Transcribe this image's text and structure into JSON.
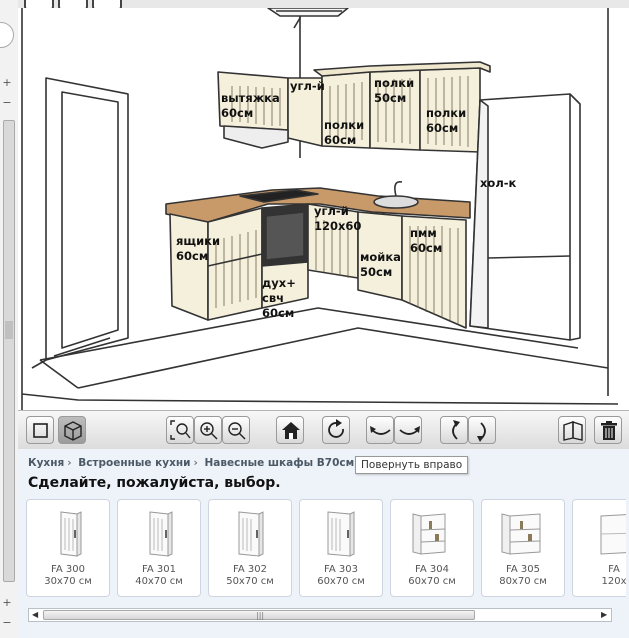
{
  "viewport": {
    "labels": {
      "hood": "вытяжка\n60см",
      "corner_wall": "угл-й",
      "shelf_60_a": "полки\n60см",
      "shelf_50": "полки\n50см",
      "shelf_60_b": "полки\n60см",
      "fridge": "хол-к",
      "drawers": "ящики\n60см",
      "corner_base": "угл-й\n120x60",
      "dishwasher": "пмм\n60см",
      "sink": "мойка\n50см",
      "oven": "дух+\nсвч\n60см"
    }
  },
  "toolbar": {
    "tooltip": "Повернуть вправо"
  },
  "catalog": {
    "breadcrumb": [
      "Кухня",
      "Встроенные кухни",
      "Навесные шкафы B70см"
    ],
    "title": "Сделайте, пожалуйста, выбор.",
    "products": [
      {
        "name": "FA 300",
        "size": "30x70 см",
        "icon": "narrow-wall-cabinet"
      },
      {
        "name": "FA 301",
        "size": "40x70 см",
        "icon": "wall-cabinet"
      },
      {
        "name": "FA 302",
        "size": "50x70 см",
        "icon": "wall-cabinet"
      },
      {
        "name": "FA 303",
        "size": "60x70 см",
        "icon": "wall-cabinet"
      },
      {
        "name": "FA 304",
        "size": "60x70 см",
        "icon": "open-wall-cabinet"
      },
      {
        "name": "FA 305",
        "size": "80x70 см",
        "icon": "open-wall-cabinet"
      },
      {
        "name": "FA",
        "size": "120x",
        "icon": "wide-wall-cabinet"
      }
    ]
  }
}
